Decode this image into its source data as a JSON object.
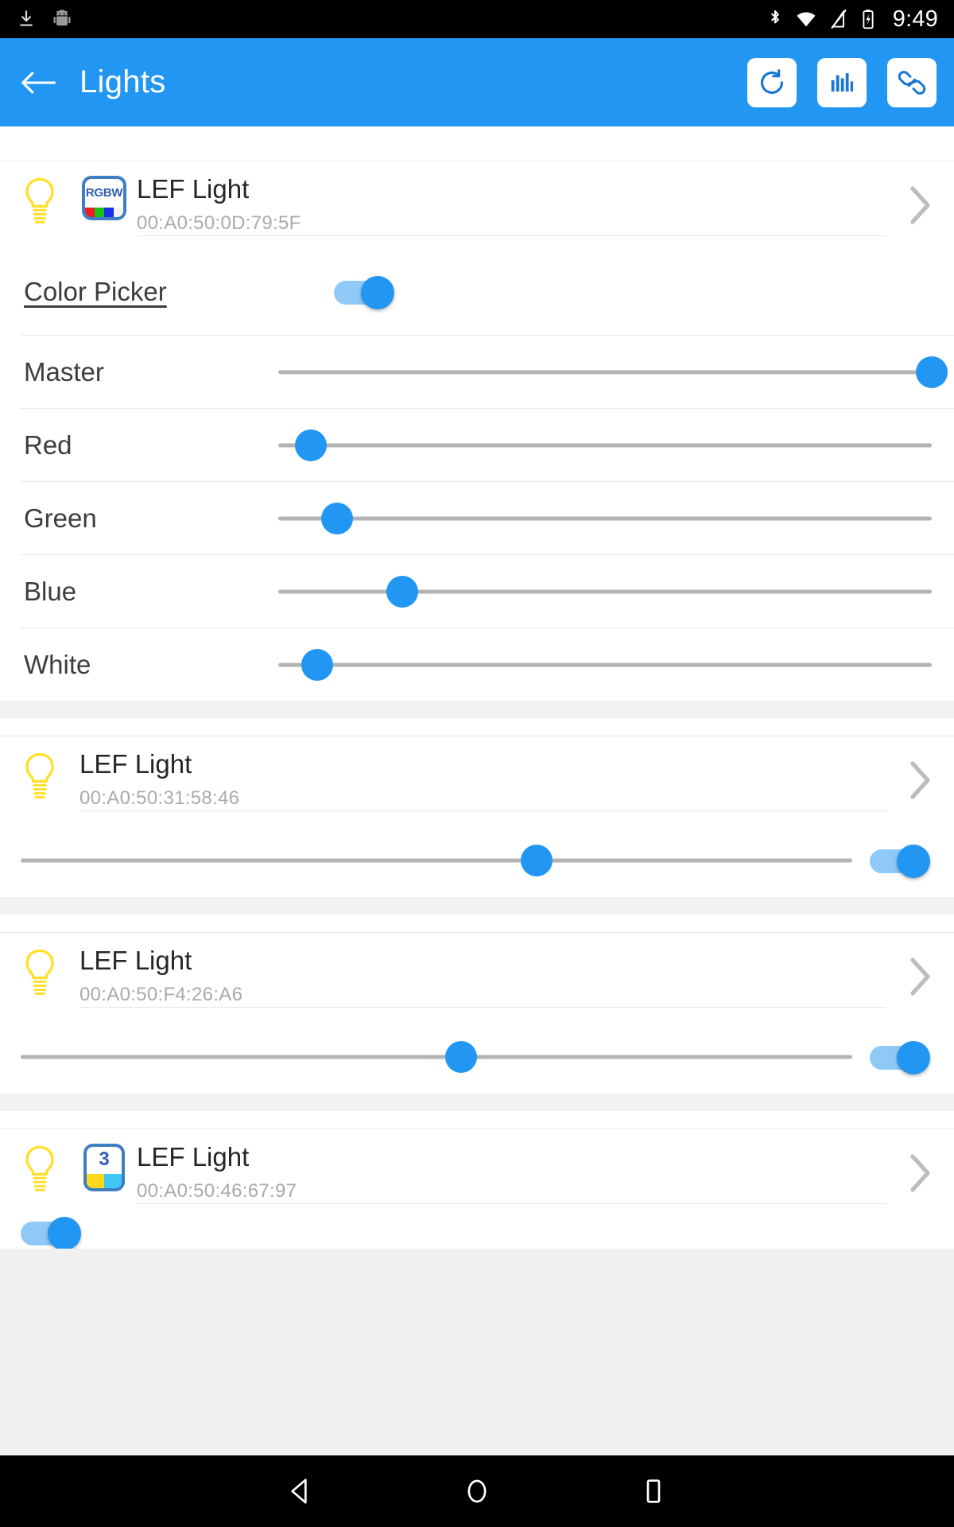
{
  "status_bar": {
    "time": "9:49",
    "left_icons": [
      "download-icon",
      "android-robot-icon"
    ],
    "right_icons": [
      "bluetooth-icon",
      "wifi-icon",
      "signal-off-icon",
      "battery-charging-icon"
    ]
  },
  "app_bar": {
    "title": "Lights",
    "back_icon": "back-arrow-icon",
    "actions": [
      {
        "name": "refresh-button",
        "icon": "refresh-icon"
      },
      {
        "name": "chart-button",
        "icon": "bar-chart-icon"
      },
      {
        "name": "link-button",
        "icon": "link-icon"
      }
    ],
    "accent_color": "#2196f3"
  },
  "colors": {
    "accent": "#2196f3",
    "track": "#b3b3b3",
    "toggle_track_on": "#8fc9f7",
    "bulb_yellow": "#ffe02e",
    "divider": "#e8e8e8",
    "mac_text": "#aaaaaa",
    "title_text": "#262626"
  },
  "lights": [
    {
      "name": "LEF Light",
      "mac": "00:A0:50:0D:79:5F",
      "bulb_icon": "light-bulb-icon",
      "badge": {
        "type": "rgbw",
        "label": "RGBW",
        "name": "rgbw-badge-icon"
      },
      "chevron": "chevron-right-icon",
      "color_picker": {
        "label": "Color Picker",
        "enabled": true
      },
      "sliders": [
        {
          "label": "Master",
          "value": 100
        },
        {
          "label": "Red",
          "value": 5
        },
        {
          "label": "Green",
          "value": 9
        },
        {
          "label": "Blue",
          "value": 19
        },
        {
          "label": "White",
          "value": 6
        }
      ]
    },
    {
      "name": "LEF Light",
      "mac": "00:A0:50:31:58:46",
      "bulb_icon": "light-bulb-icon",
      "badge": null,
      "chevron": "chevron-right-icon",
      "brightness": {
        "value": 62
      },
      "power": {
        "enabled": true
      }
    },
    {
      "name": "LEF Light",
      "mac": "00:A0:50:F4:26:A6",
      "bulb_icon": "light-bulb-icon",
      "badge": null,
      "chevron": "chevron-right-icon",
      "brightness": {
        "value": 53
      },
      "power": {
        "enabled": true
      }
    },
    {
      "name": "LEF Light",
      "mac": "00:A0:50:46:67:97",
      "bulb_icon": "light-bulb-icon",
      "badge": {
        "type": "number",
        "label": "3",
        "name": "scene-3-badge-icon"
      },
      "chevron": "chevron-right-icon",
      "power": {
        "enabled": true
      }
    }
  ],
  "nav_bar": {
    "buttons": [
      {
        "name": "nav-back-button",
        "icon": "triangle-back-icon"
      },
      {
        "name": "nav-home-button",
        "icon": "circle-home-icon"
      },
      {
        "name": "nav-recents-button",
        "icon": "square-recents-icon"
      }
    ]
  }
}
